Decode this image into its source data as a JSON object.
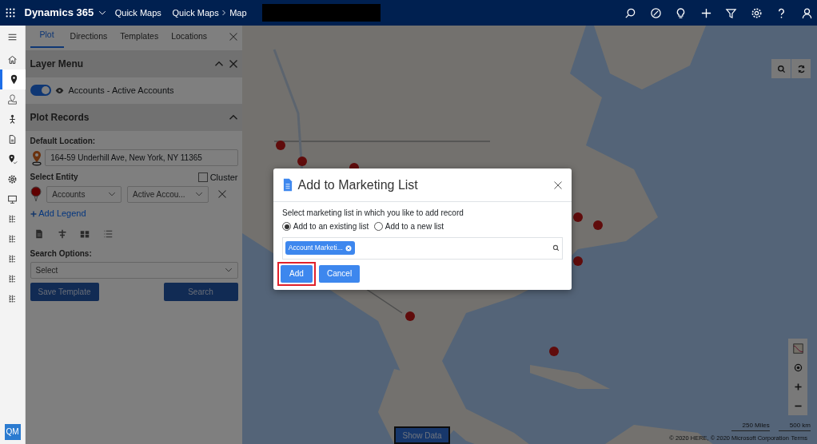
{
  "header": {
    "app_title": "Dynamics 365",
    "app_name": "Quick Maps",
    "breadcrumbs": [
      "Quick Maps",
      "Map"
    ]
  },
  "rail_items": [
    {
      "kind": "menu",
      "selected": false
    },
    {
      "kind": "home",
      "selected": false
    },
    {
      "kind": "pin",
      "selected": true
    },
    {
      "kind": "map-pin",
      "selected": false
    },
    {
      "kind": "route",
      "selected": false
    },
    {
      "kind": "document",
      "selected": false
    },
    {
      "kind": "pin-check",
      "selected": false
    },
    {
      "kind": "gear",
      "selected": false
    },
    {
      "kind": "monitor",
      "selected": false
    },
    {
      "kind": "hierarchy",
      "selected": false
    },
    {
      "kind": "hierarchy",
      "selected": false
    },
    {
      "kind": "hierarchy",
      "selected": false
    },
    {
      "kind": "hierarchy",
      "selected": false
    },
    {
      "kind": "hierarchy",
      "selected": false
    }
  ],
  "rail_badge": "QM",
  "panel": {
    "tabs": [
      {
        "label": "Plot",
        "selected": true
      },
      {
        "label": "Directions",
        "selected": false
      },
      {
        "label": "Templates",
        "selected": false
      },
      {
        "label": "Locations",
        "selected": false
      }
    ],
    "layer_menu": {
      "title": "Layer Menu",
      "layers": [
        {
          "label": "Accounts - Active Accounts",
          "on": true
        }
      ]
    },
    "plot_records": {
      "title": "Plot Records",
      "default_location_label": "Default Location:",
      "default_location": "164-59 Underhill Ave, New York, NY 11365",
      "select_entity_label": "Select Entity",
      "cluster": {
        "label": "Cluster",
        "checked": false
      },
      "entity": "Accounts",
      "view": "Active Accou...",
      "add_legend": "Add Legend",
      "search_options_label": "Search Options:",
      "search_options_value": "Select",
      "save_button": "Save Template",
      "search_button": "Search"
    }
  },
  "map": {
    "show_data": "Show Data",
    "scale": [
      "250 Miles",
      "500 km"
    ],
    "copyright": "© 2020 HERE, © 2020 Microsoft Corporation",
    "terms": "Terms"
  },
  "dialog": {
    "title": "Add to Marketing List",
    "prompt": "Select marketing list in which you like to add record",
    "options": [
      {
        "label": "Add to an existing list",
        "selected": true
      },
      {
        "label": "Add to a new list",
        "selected": false
      }
    ],
    "tags": [
      "Account Marketi..."
    ],
    "buttons": [
      {
        "label": "Add",
        "highlighted": true
      },
      {
        "label": "Cancel",
        "highlighted": false
      }
    ]
  }
}
